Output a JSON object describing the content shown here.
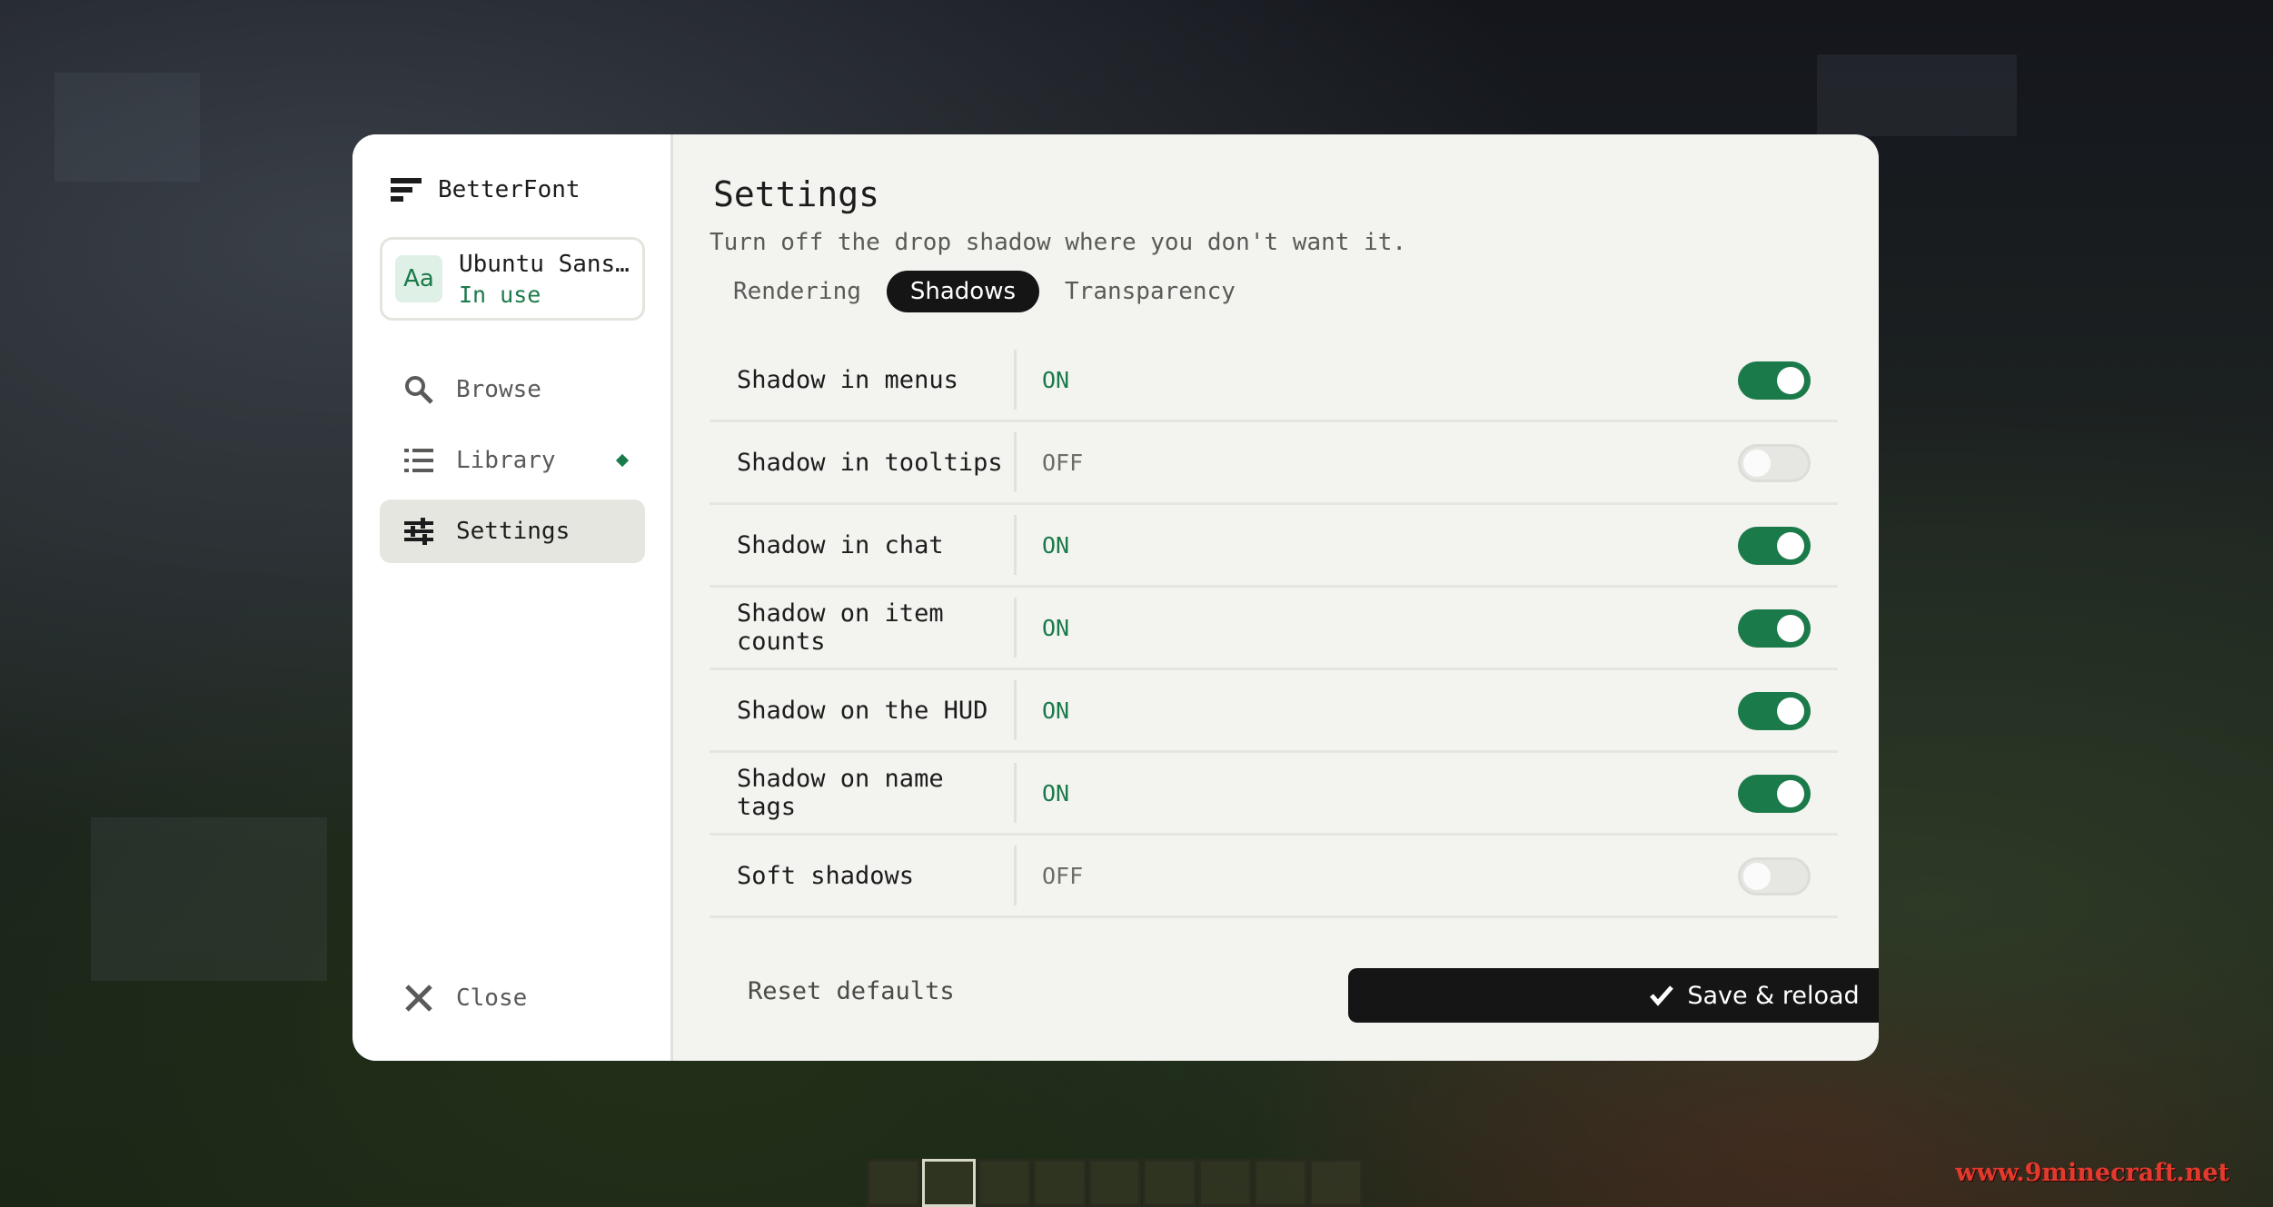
{
  "app": {
    "name": "BetterFont"
  },
  "font_card": {
    "badge": "Aa",
    "name": "Ubuntu Sans…",
    "status": "In use"
  },
  "nav": {
    "items": [
      {
        "label": "Browse",
        "icon": "search-icon"
      },
      {
        "label": "Library",
        "icon": "list-icon",
        "indicator": true
      },
      {
        "label": "Settings",
        "icon": "sliders-icon",
        "active": true
      }
    ],
    "close_label": "Close"
  },
  "page": {
    "title": "Settings",
    "subtitle": "Turn off the drop shadow where you don't want it.",
    "tabs": [
      {
        "label": "Rendering",
        "active": false
      },
      {
        "label": "Shadows",
        "active": true
      },
      {
        "label": "Transparency",
        "active": false
      }
    ]
  },
  "settings": [
    {
      "label": "Shadow in menus",
      "value": "ON",
      "enabled": true
    },
    {
      "label": "Shadow in tooltips",
      "value": "OFF",
      "enabled": false
    },
    {
      "label": "Shadow in chat",
      "value": "ON",
      "enabled": true
    },
    {
      "label": "Shadow on item counts",
      "value": "ON",
      "enabled": true
    },
    {
      "label": "Shadow on the HUD",
      "value": "ON",
      "enabled": true
    },
    {
      "label": "Shadow on name tags",
      "value": "ON",
      "enabled": true
    },
    {
      "label": "Soft shadows",
      "value": "OFF",
      "enabled": false
    }
  ],
  "footer": {
    "reset_label": "Reset defaults",
    "save_label": "Save & reload",
    "save_icon": "checkmark-icon"
  },
  "watermark": "www.9minecraft.net",
  "colors": {
    "accent": "#1b7a4a",
    "dark": "#151515",
    "panel": "#f3f3ef"
  }
}
